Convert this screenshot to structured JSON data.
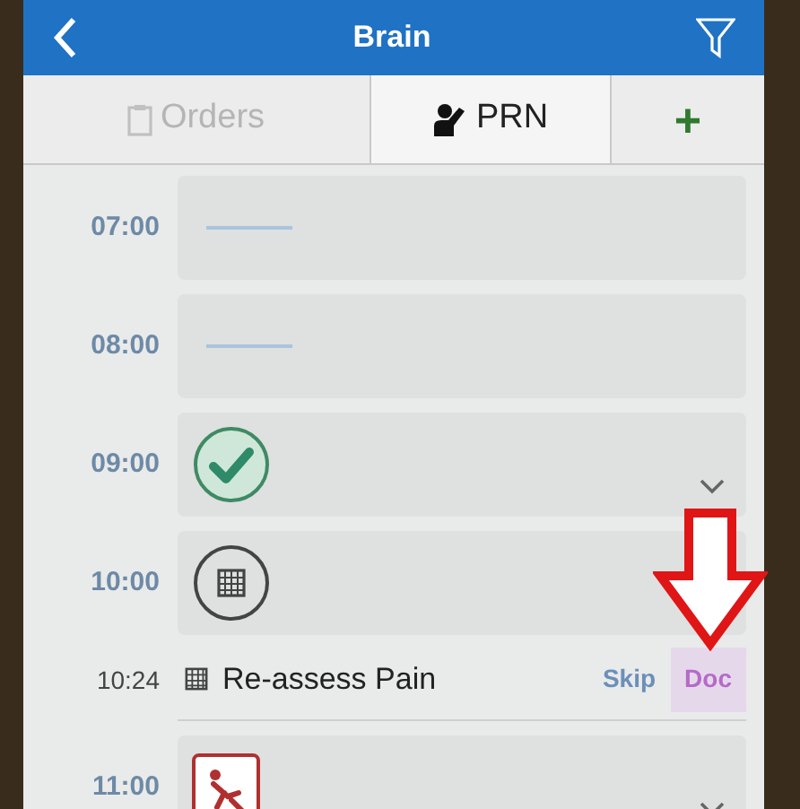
{
  "header": {
    "title": "Brain"
  },
  "tabs": [
    {
      "kind": "orders",
      "label": "Orders",
      "disabled": true
    },
    {
      "kind": "prn",
      "label": "PRN",
      "disabled": false
    },
    {
      "kind": "add",
      "label": "+",
      "disabled": false
    }
  ],
  "slots": [
    {
      "kind": "empty",
      "time": "07:00",
      "collapsible": false
    },
    {
      "kind": "empty",
      "time": "08:00",
      "collapsible": false
    },
    {
      "kind": "done",
      "time": "09:00",
      "collapsible": true
    },
    {
      "kind": "task",
      "time": "10:00"
    },
    {
      "kind": "item",
      "time": "10:24",
      "title": "Re-assess Pain",
      "actions": [
        "Skip",
        "Doc"
      ]
    },
    {
      "kind": "alert",
      "time": "11:00",
      "collapsible": true
    }
  ]
}
